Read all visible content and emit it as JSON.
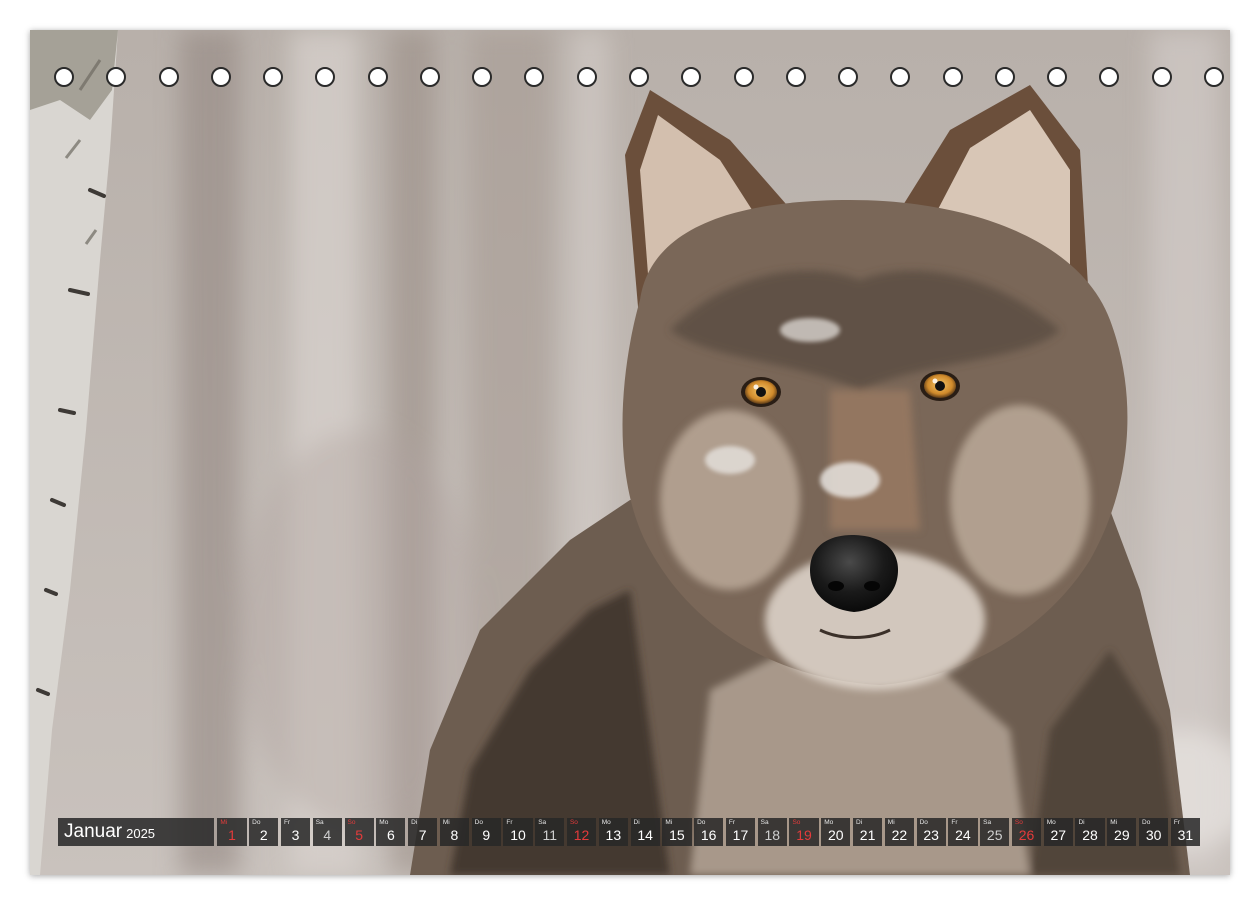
{
  "calendar": {
    "month": "Januar",
    "year": "2025",
    "days": [
      {
        "wd": "Mi",
        "n": "1",
        "k": "holiday"
      },
      {
        "wd": "Do",
        "n": "2",
        "k": ""
      },
      {
        "wd": "Fr",
        "n": "3",
        "k": ""
      },
      {
        "wd": "Sa",
        "n": "4",
        "k": "weekend"
      },
      {
        "wd": "So",
        "n": "5",
        "k": "holiday"
      },
      {
        "wd": "Mo",
        "n": "6",
        "k": ""
      },
      {
        "wd": "Di",
        "n": "7",
        "k": ""
      },
      {
        "wd": "Mi",
        "n": "8",
        "k": ""
      },
      {
        "wd": "Do",
        "n": "9",
        "k": ""
      },
      {
        "wd": "Fr",
        "n": "10",
        "k": ""
      },
      {
        "wd": "Sa",
        "n": "11",
        "k": "weekend"
      },
      {
        "wd": "So",
        "n": "12",
        "k": "holiday"
      },
      {
        "wd": "Mo",
        "n": "13",
        "k": ""
      },
      {
        "wd": "Di",
        "n": "14",
        "k": ""
      },
      {
        "wd": "Mi",
        "n": "15",
        "k": ""
      },
      {
        "wd": "Do",
        "n": "16",
        "k": ""
      },
      {
        "wd": "Fr",
        "n": "17",
        "k": ""
      },
      {
        "wd": "Sa",
        "n": "18",
        "k": "weekend"
      },
      {
        "wd": "So",
        "n": "19",
        "k": "holiday"
      },
      {
        "wd": "Mo",
        "n": "20",
        "k": ""
      },
      {
        "wd": "Di",
        "n": "21",
        "k": ""
      },
      {
        "wd": "Mi",
        "n": "22",
        "k": ""
      },
      {
        "wd": "Do",
        "n": "23",
        "k": ""
      },
      {
        "wd": "Fr",
        "n": "24",
        "k": ""
      },
      {
        "wd": "Sa",
        "n": "25",
        "k": "weekend"
      },
      {
        "wd": "So",
        "n": "26",
        "k": "holiday"
      },
      {
        "wd": "Mo",
        "n": "27",
        "k": ""
      },
      {
        "wd": "Di",
        "n": "28",
        "k": ""
      },
      {
        "wd": "Mi",
        "n": "29",
        "k": ""
      },
      {
        "wd": "Do",
        "n": "30",
        "k": ""
      },
      {
        "wd": "Fr",
        "n": "31",
        "k": ""
      }
    ]
  },
  "binding_hole_count": 23,
  "colors": {
    "background": "#bdb6b1",
    "fur_dark": "#4a3d33",
    "fur_light": "#d8cfc6",
    "eye": "#e0a13c",
    "holiday_red": "#e43b3b"
  }
}
